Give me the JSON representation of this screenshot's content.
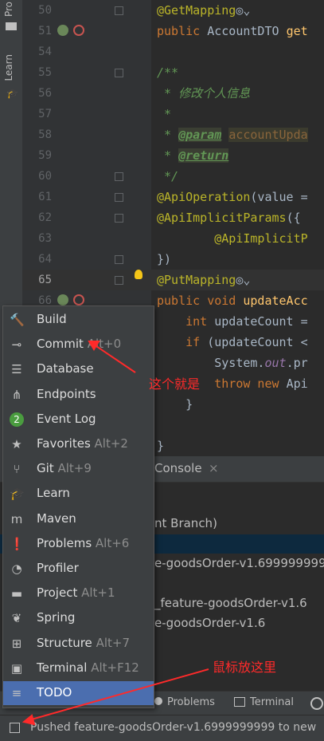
{
  "left_tabs": [
    "Pro",
    "Learn"
  ],
  "editor": {
    "lines": [
      {
        "num": "50",
        "tokens": [
          {
            "t": "@GetMapping",
            "c": "ann"
          },
          {
            "t": "◎⌄",
            "c": ""
          }
        ]
      },
      {
        "num": "51",
        "tokens": [
          {
            "t": "public ",
            "c": "kw"
          },
          {
            "t": "AccountDTO ",
            "c": ""
          },
          {
            "t": "get",
            "c": "fn"
          }
        ]
      },
      {
        "num": "54",
        "tokens": []
      },
      {
        "num": "55",
        "tokens": [
          {
            "t": "/**",
            "c": "doc"
          }
        ]
      },
      {
        "num": "56",
        "tokens": [
          {
            "t": " * 修改个人信息",
            "c": "doc"
          }
        ]
      },
      {
        "num": "57",
        "tokens": [
          {
            "t": " *",
            "c": "doc"
          }
        ]
      },
      {
        "num": "58",
        "tokens": [
          {
            "t": " * ",
            "c": "doc"
          },
          {
            "t": "@param",
            "c": "tag"
          },
          {
            "t": " ",
            "c": "doc"
          },
          {
            "t": "accountUpda",
            "c": "param"
          }
        ]
      },
      {
        "num": "59",
        "tokens": [
          {
            "t": " * ",
            "c": "doc"
          },
          {
            "t": "@return",
            "c": "tag"
          }
        ]
      },
      {
        "num": "60",
        "tokens": [
          {
            "t": " */",
            "c": "doc"
          }
        ]
      },
      {
        "num": "61",
        "tokens": [
          {
            "t": "@ApiOperation",
            "c": "ann"
          },
          {
            "t": "(value =",
            "c": ""
          }
        ]
      },
      {
        "num": "62",
        "tokens": [
          {
            "t": "@ApiImplicitParams",
            "c": "ann"
          },
          {
            "t": "({",
            "c": ""
          }
        ]
      },
      {
        "num": "63",
        "tokens": [
          {
            "t": "        @ApiImplicitP",
            "c": "ann"
          }
        ]
      },
      {
        "num": "64",
        "tokens": [
          {
            "t": "})",
            "c": ""
          }
        ]
      },
      {
        "num": "65",
        "tokens": [
          {
            "t": "@PutMapping",
            "c": "ann"
          },
          {
            "t": "◎⌄",
            "c": ""
          }
        ]
      },
      {
        "num": "66",
        "tokens": [
          {
            "t": "public void ",
            "c": "kw"
          },
          {
            "t": "updateAcc",
            "c": "fn"
          }
        ]
      },
      {
        "num": "",
        "tokens": [
          {
            "t": "    int ",
            "c": "kw"
          },
          {
            "t": "updateCount =",
            "c": ""
          }
        ]
      },
      {
        "num": "",
        "tokens": [
          {
            "t": "    if ",
            "c": "kw"
          },
          {
            "t": "(updateCount <",
            "c": ""
          }
        ]
      },
      {
        "num": "",
        "tokens": [
          {
            "t": "        System.",
            "c": ""
          },
          {
            "t": "out",
            "c": "field"
          },
          {
            "t": ".pr",
            "c": ""
          }
        ]
      },
      {
        "num": "",
        "tokens": [
          {
            "t": "        throw new ",
            "c": "kw"
          },
          {
            "t": "Api",
            "c": ""
          }
        ]
      },
      {
        "num": "",
        "tokens": [
          {
            "t": "    }",
            "c": ""
          }
        ]
      },
      {
        "num": "",
        "tokens": []
      },
      {
        "num": "",
        "tokens": [
          {
            "t": "}",
            "c": ""
          }
        ]
      }
    ]
  },
  "console": {
    "tab_label": "Console",
    "close": "×",
    "rows": [
      "nt Branch)",
      "e-goodsOrder-v1.6999999999",
      "_feature-goodsOrder-v1.6",
      "e-goodsOrder-v1.6"
    ]
  },
  "bottom_tabs": [
    {
      "label": "Problems",
      "icon": "problems-icon"
    },
    {
      "label": "Terminal",
      "icon": "terminal-icon"
    }
  ],
  "status_text": "Pushed feature-goodsOrder-v1.6999999999 to new",
  "popup": {
    "items": [
      {
        "label": "Build",
        "shortcut": "",
        "icon": "build-icon",
        "glyph": "🔨",
        "name": "build"
      },
      {
        "label": "Commit",
        "shortcut": "Alt+0",
        "icon": "commit-icon",
        "glyph": "⊸",
        "name": "commit"
      },
      {
        "label": "Database",
        "shortcut": "",
        "icon": "database-icon",
        "glyph": "☰",
        "name": "database"
      },
      {
        "label": "Endpoints",
        "shortcut": "",
        "icon": "endpoints-icon",
        "glyph": "⋔",
        "name": "endpoints"
      },
      {
        "label": "Event Log",
        "shortcut": "",
        "icon": "event-log-icon",
        "glyph": "2",
        "name": "event-log"
      },
      {
        "label": "Favorites",
        "shortcut": "Alt+2",
        "icon": "favorites-icon",
        "glyph": "★",
        "name": "favorites"
      },
      {
        "label": "Git",
        "shortcut": "Alt+9",
        "icon": "git-icon",
        "glyph": "⑂",
        "name": "git"
      },
      {
        "label": "Learn",
        "shortcut": "",
        "icon": "learn-icon",
        "glyph": "🎓",
        "name": "learn"
      },
      {
        "label": "Maven",
        "shortcut": "",
        "icon": "maven-icon",
        "glyph": "m",
        "name": "maven"
      },
      {
        "label": "Problems",
        "shortcut": "Alt+6",
        "icon": "problems-icon",
        "glyph": "❗",
        "name": "problems"
      },
      {
        "label": "Profiler",
        "shortcut": "",
        "icon": "profiler-icon",
        "glyph": "◔",
        "name": "profiler"
      },
      {
        "label": "Project",
        "shortcut": "Alt+1",
        "icon": "project-icon",
        "glyph": "▬",
        "name": "project"
      },
      {
        "label": "Spring",
        "shortcut": "",
        "icon": "spring-icon",
        "glyph": "❦",
        "name": "spring"
      },
      {
        "label": "Structure",
        "shortcut": "Alt+7",
        "icon": "structure-icon",
        "glyph": "⊞",
        "name": "structure"
      },
      {
        "label": "Terminal",
        "shortcut": "Alt+F12",
        "icon": "terminal-icon",
        "glyph": "▣",
        "name": "terminal"
      },
      {
        "label": "TODO",
        "shortcut": "",
        "icon": "todo-icon",
        "glyph": "≡",
        "name": "todo",
        "selected": true
      }
    ]
  },
  "annotations": {
    "note1": "这个就是",
    "note2": "鼠标放这里",
    "color": "#ff2a2a"
  },
  "colors": {
    "popup_selection": "#4b6eaf",
    "annotation": "#ff2a2a"
  }
}
